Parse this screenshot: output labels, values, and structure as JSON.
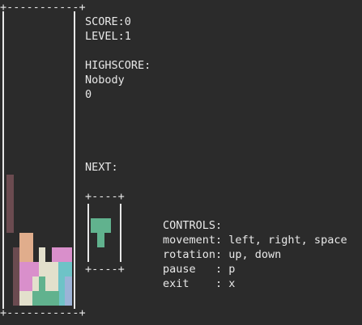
{
  "colors": {
    "background": "#2b2b2b",
    "text": "#e8e8e8",
    "piece_maroon": "#6b4b50",
    "piece_peach": "#e0ad8c",
    "piece_pink": "#d98fcb",
    "piece_cream": "#e3e0cc",
    "piece_green": "#61b28e",
    "piece_teal": "#6ec3c7",
    "piece_blue": "#9cb3d7"
  },
  "board": {
    "border_top": "+-----------+",
    "border_bottom": "+-----------+",
    "wall": "|"
  },
  "stats": {
    "score_line": "SCORE:0",
    "level_line": "LEVEL:1",
    "highscore_label": "HIGHSCORE:",
    "highscore_name": "Nobody",
    "highscore_value": "0"
  },
  "next": {
    "label": "NEXT:",
    "box_top": "+----+",
    "box_bottom": "+----+",
    "piece": "T",
    "piece_color": "#61b28e"
  },
  "controls": {
    "title": "CONTROLS:",
    "movement": "movement: left, right, space",
    "rotation": "rotation: up, down",
    "pause": "pause   : p",
    "exit": "exit    : x"
  }
}
